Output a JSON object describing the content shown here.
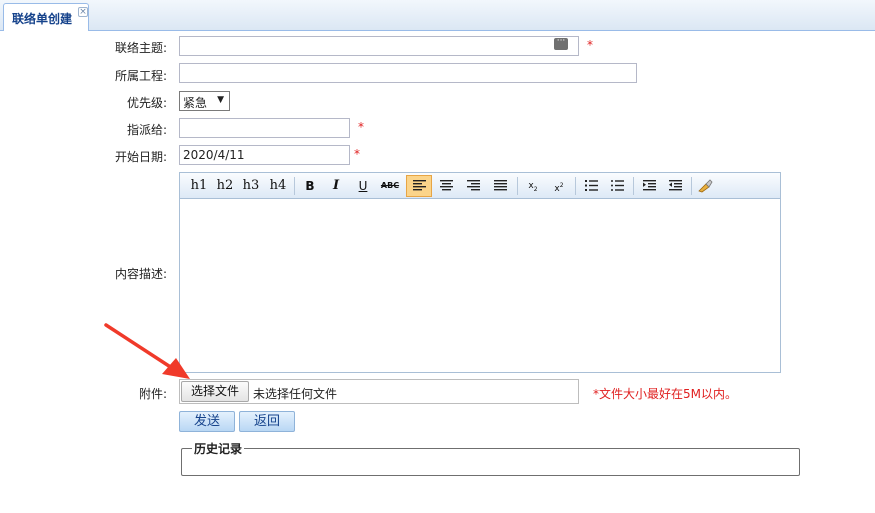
{
  "tab": {
    "title": "联络单创建",
    "close": "×"
  },
  "form": {
    "subject": {
      "label": "联络主题:",
      "value": "",
      "required": "*"
    },
    "project": {
      "label": "所属工程:",
      "value": ""
    },
    "priority": {
      "label": "优先级:",
      "selected": "紧急",
      "caret": "▼"
    },
    "assignee": {
      "label": "指派给:",
      "value": "",
      "required": "*"
    },
    "start_date": {
      "label": "开始日期:",
      "value": "2020/4/11",
      "required": "*"
    },
    "description": {
      "label": "内容描述:"
    },
    "attachment": {
      "label": "附件:",
      "button": "选择文件",
      "status": "未选择任何文件",
      "hint": "*文件大小最好在5M以内。"
    }
  },
  "toolbar": {
    "h1": "h1",
    "h2": "h2",
    "h3": "h3",
    "h4": "h4",
    "bold": "B",
    "italic": "I",
    "underline": "U",
    "strike": "ABC",
    "icons": [
      "align-left-icon",
      "align-center-icon",
      "align-right-icon",
      "align-justify-icon",
      "subscript-icon",
      "superscript-icon",
      "ordered-list-icon",
      "unordered-list-icon",
      "indent-icon",
      "outdent-icon",
      "clear-format-icon"
    ],
    "active": "align-left-icon"
  },
  "buttons": {
    "submit": "发送",
    "back": "返回"
  },
  "history": {
    "legend": "历史记录"
  },
  "colors": {
    "required": "#e02020",
    "accent": "#15428b",
    "arrow": "#f03a2a"
  }
}
